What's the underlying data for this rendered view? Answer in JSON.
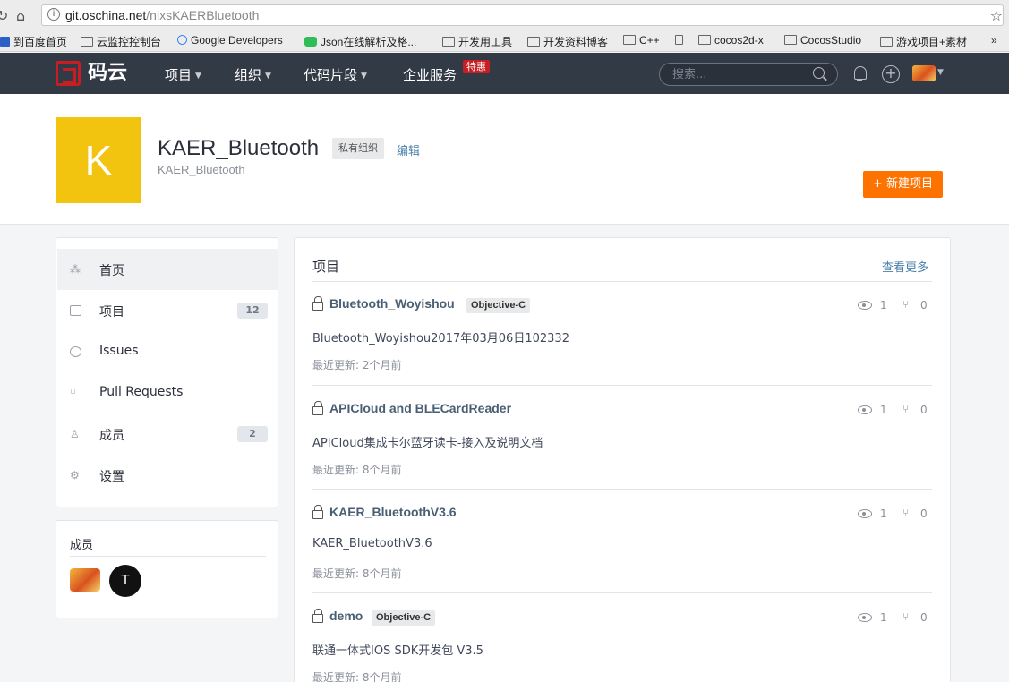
{
  "browser": {
    "url_host": "git.oschina.net",
    "url_path": "/nixsKAERBluetooth",
    "bookmarks": [
      "到百度首页",
      "云监控控制台",
      "Google Developers",
      "Json在线解析及格...",
      "开发用工具",
      "开发资料博客",
      "C++",
      "cocos2d-x",
      "CocosStudio",
      "游戏项目+素材"
    ],
    "overflow": "»"
  },
  "nav": {
    "logo": "码云",
    "items": [
      "项目",
      "组织",
      "代码片段",
      "企业服务"
    ],
    "hot_badge": "特惠",
    "search_placeholder": "搜索..."
  },
  "org": {
    "avatar_letter": "K",
    "name": "KAER_Bluetooth",
    "private_tag": "私有组织",
    "edit": "编辑",
    "path": "KAER_Bluetooth",
    "new_project": "+ 新建项目"
  },
  "sidebar": {
    "items": [
      {
        "label": "首页",
        "count": ""
      },
      {
        "label": "项目",
        "count": "12"
      },
      {
        "label": "Issues",
        "count": ""
      },
      {
        "label": "Pull Requests",
        "count": ""
      },
      {
        "label": "成员",
        "count": "2"
      },
      {
        "label": "设置",
        "count": ""
      }
    ]
  },
  "members": {
    "title": "成员",
    "second_initial": "T"
  },
  "projects": {
    "title": "项目",
    "more": "查看更多",
    "items": [
      {
        "name": "Bluetooth_Woyishou",
        "lang": "Objective-C",
        "desc": "Bluetooth_Woyishou2017年03月06日102332",
        "updated": "最近更新: 2个月前",
        "watch": "1",
        "fork": "0"
      },
      {
        "name": "APICloud and BLECardReader",
        "lang": "",
        "desc": "APICloud集成卡尔蓝牙读卡-接入及说明文档",
        "updated": "最近更新: 8个月前",
        "watch": "1",
        "fork": "0"
      },
      {
        "name": "KAER_BluetoothV3.6",
        "lang": "",
        "desc": "KAER_BluetoothV3.6",
        "updated": "最近更新: 8个月前",
        "watch": "1",
        "fork": "0"
      },
      {
        "name": "demo",
        "lang": "Objective-C",
        "desc": "联通一体式IOS SDK开发包 V3.5",
        "updated": "最近更新: 8个月前",
        "watch": "1",
        "fork": "0"
      }
    ]
  }
}
